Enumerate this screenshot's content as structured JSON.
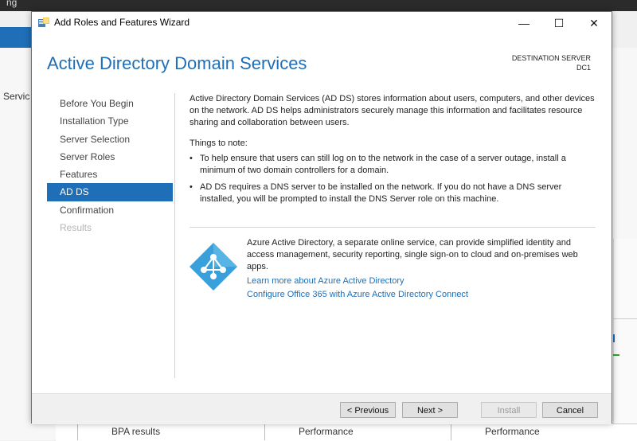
{
  "background": {
    "topbar_text": "ng",
    "services_label": "Servic",
    "bottom_cells": [
      "BPA results",
      "Performance",
      "Performance"
    ]
  },
  "window": {
    "title": "Add Roles and Features Wizard",
    "minimize": "—",
    "maximize": "☐",
    "close": "✕"
  },
  "header": {
    "page_title": "Active Directory Domain Services",
    "destination_label": "DESTINATION SERVER",
    "destination_server": "DC1"
  },
  "nav": {
    "items": [
      {
        "label": "Before You Begin",
        "state": "normal"
      },
      {
        "label": "Installation Type",
        "state": "normal"
      },
      {
        "label": "Server Selection",
        "state": "normal"
      },
      {
        "label": "Server Roles",
        "state": "normal"
      },
      {
        "label": "Features",
        "state": "normal"
      },
      {
        "label": "AD DS",
        "state": "active"
      },
      {
        "label": "Confirmation",
        "state": "normal"
      },
      {
        "label": "Results",
        "state": "disabled"
      }
    ]
  },
  "content": {
    "intro": "Active Directory Domain Services (AD DS) stores information about users, computers, and other devices on the network.  AD DS helps administrators securely manage this information and facilitates resource sharing and collaboration between users.",
    "note_heading": "Things to note:",
    "bullets": [
      "To help ensure that users can still log on to the network in the case of a server outage, install a minimum of two domain controllers for a domain.",
      "AD DS requires a DNS server to be installed on the network.  If you do not have a DNS server installed, you will be prompted to install the DNS Server role on this machine."
    ],
    "bullet_char": "•",
    "azure_text": "Azure Active Directory, a separate online service, can provide simplified identity and access management, security reporting, single sign-on to cloud and on-premises web apps.",
    "azure_link_1": "Learn more about Azure Active Directory",
    "azure_link_2": "Configure Office 365 with Azure Active Directory Connect"
  },
  "footer": {
    "previous": "< Previous",
    "next": "Next >",
    "install": "Install",
    "cancel": "Cancel"
  },
  "colors": {
    "accent": "#1e6fb8",
    "azure_icon": "#3aa0dc"
  }
}
